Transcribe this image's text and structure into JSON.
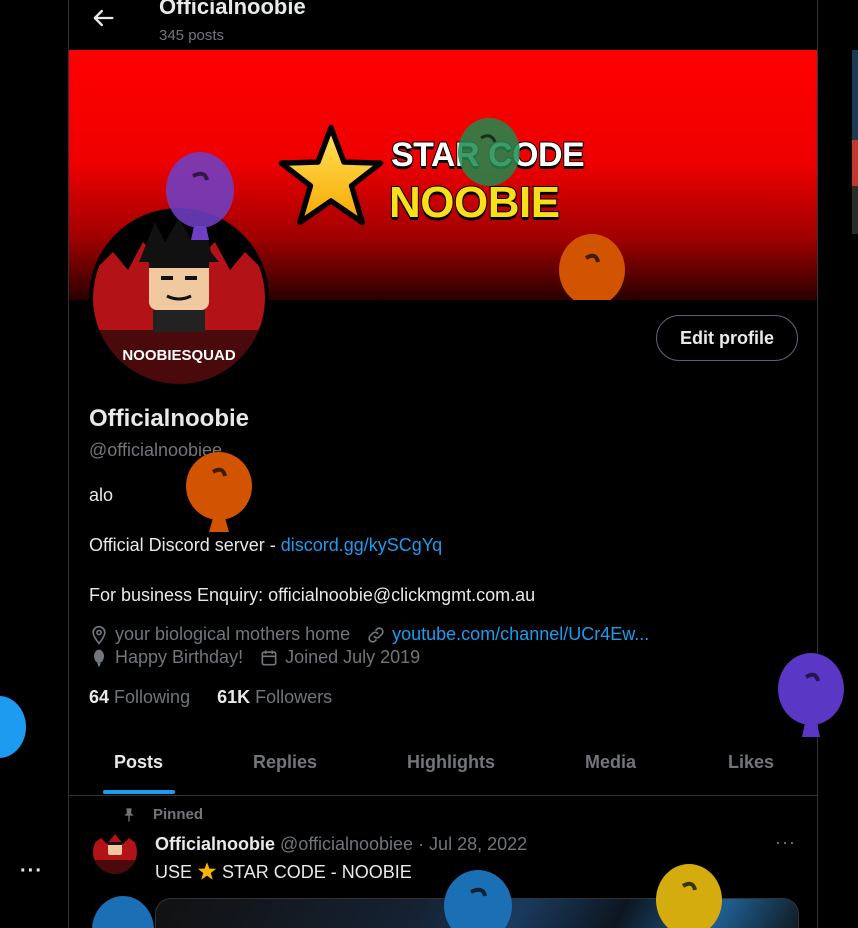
{
  "header": {
    "name": "Officialnoobie",
    "post_count": "345 posts"
  },
  "banner": {
    "line1": "STAR CODE",
    "line2": "NOOBIE"
  },
  "avatar": {
    "label": "NOOBIESQUAD"
  },
  "edit_profile_label": "Edit profile",
  "profile": {
    "name": "Officialnoobie",
    "handle": "@officialnoobiee",
    "bio_line1": "alo",
    "bio_line2_prefix": "Official Discord server - ",
    "bio_line2_link": "discord.gg/kySCgYq",
    "bio_line3": "For business Enquiry: officialnoobie@clickmgmt.com.au",
    "location": "your biological mothers home",
    "website": "youtube.com/channel/UCr4Ew...",
    "birthday": "Happy Birthday!",
    "joined": "Joined July 2019"
  },
  "stats": {
    "following_count": "64",
    "following_label": "Following",
    "followers_count": "61K",
    "followers_label": "Followers"
  },
  "tabs": [
    {
      "label": "Posts",
      "active": true
    },
    {
      "label": "Replies"
    },
    {
      "label": "Highlights"
    },
    {
      "label": "Media"
    },
    {
      "label": "Likes"
    }
  ],
  "pinned_post": {
    "pinned_label": "Pinned",
    "author": "Officialnoobie",
    "meta": "@officialnoobiee · Jul 28, 2022",
    "text_before": "USE",
    "text_after": "STAR CODE - NOOBIE",
    "more": "···"
  },
  "left_more": "···",
  "colors": {
    "accent": "#1d9bf0",
    "banner_red": "#ff0000",
    "balloon_purple": "#6f3fc4",
    "balloon_orange": "#d35400",
    "balloon_green": "#1e8a4f",
    "balloon_blue": "#1a6fb5",
    "balloon_yellow": "#d4ac0d"
  }
}
